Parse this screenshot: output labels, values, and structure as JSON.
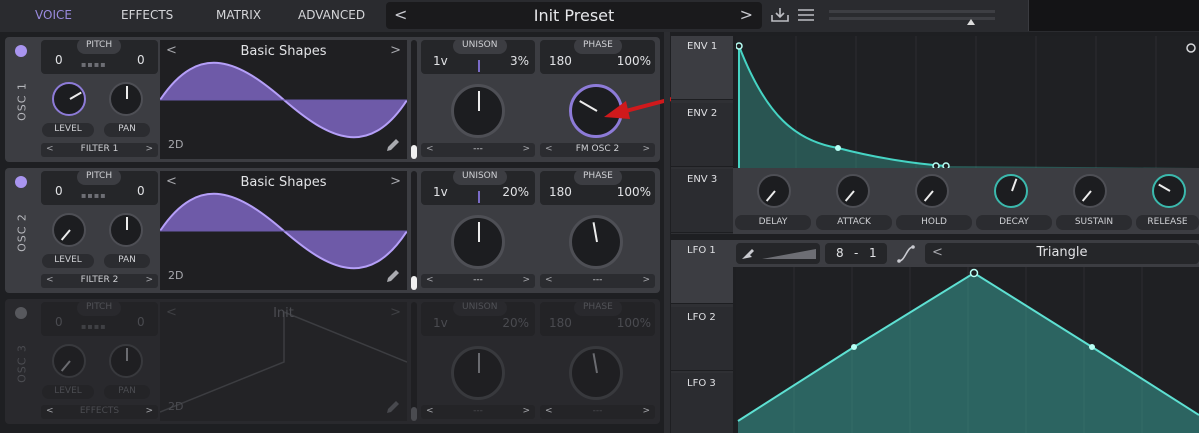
{
  "nav": {
    "tabs": [
      "VOICE",
      "EFFECTS",
      "MATRIX",
      "ADVANCED"
    ]
  },
  "preset": {
    "name": "Init Preset",
    "prev": "<",
    "next": ">"
  },
  "colors": {
    "accent": "#9a8be0",
    "wave_fill": "#8a6fd6",
    "env_teal": "#3bb9ad",
    "panel": "#3c3d42",
    "arrow": "#d0191c"
  },
  "oscillators": [
    {
      "title": "OSC 1",
      "enabled": true,
      "pitch_label": "PITCH",
      "transpose": "0",
      "tune": "0",
      "level_label": "LEVEL",
      "pan_label": "PAN",
      "filter": "FILTER 1",
      "wave_name": "Basic Shapes",
      "wave_dim": "2D",
      "unison_label": "UNISON",
      "voices": "1v",
      "detune": "3%",
      "unison_mod": "---",
      "phase_label": "PHASE",
      "phase": "180",
      "phase_random": "100%",
      "phase_mod": "FM OSC 2"
    },
    {
      "title": "OSC 2",
      "enabled": true,
      "pitch_label": "PITCH",
      "transpose": "0",
      "tune": "0",
      "level_label": "LEVEL",
      "pan_label": "PAN",
      "filter": "FILTER 2",
      "wave_name": "Basic Shapes",
      "wave_dim": "2D",
      "unison_label": "UNISON",
      "voices": "1v",
      "detune": "20%",
      "unison_mod": "---",
      "phase_label": "PHASE",
      "phase": "180",
      "phase_random": "100%",
      "phase_mod": "---"
    },
    {
      "title": "OSC 3",
      "enabled": false,
      "pitch_label": "PITCH",
      "transpose": "0",
      "tune": "0",
      "level_label": "LEVEL",
      "pan_label": "PAN",
      "filter": "EFFECTS",
      "wave_name": "Init",
      "wave_dim": "2D",
      "unison_label": "UNISON",
      "voices": "1v",
      "detune": "20%",
      "unison_mod": "---",
      "phase_label": "PHASE",
      "phase": "180",
      "phase_random": "100%",
      "phase_mod": "---"
    }
  ],
  "envelopes": {
    "tabs": [
      "ENV 1",
      "ENV 2",
      "ENV 3"
    ],
    "knobs": [
      "DELAY",
      "ATTACK",
      "HOLD",
      "DECAY",
      "SUSTAIN",
      "RELEASE"
    ]
  },
  "lfos": {
    "tabs": [
      "LFO 1",
      "LFO 2",
      "LFO 3"
    ],
    "rate_num": "8",
    "rate_sep": "-",
    "rate_den": "1",
    "shape": "Triangle"
  }
}
